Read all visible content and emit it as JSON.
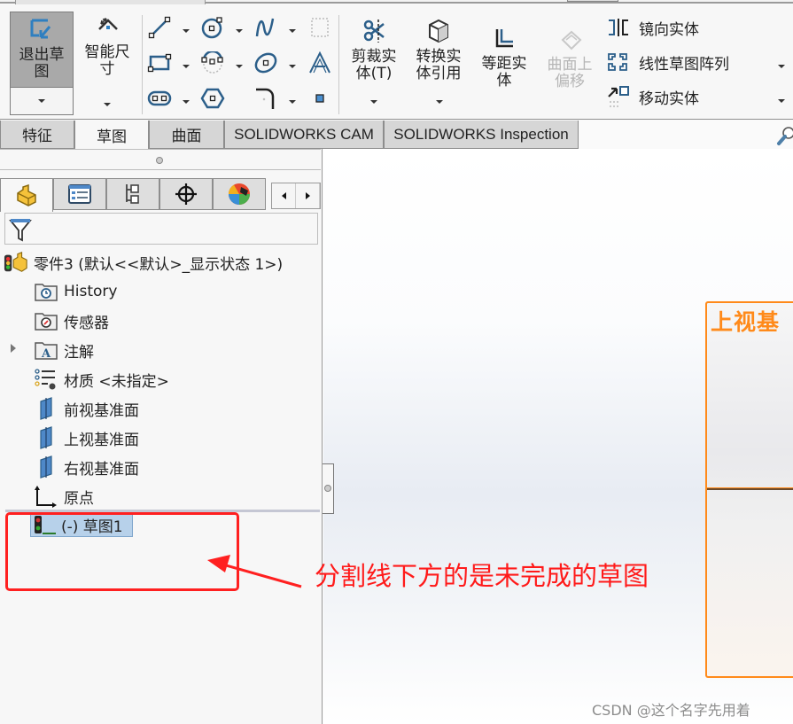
{
  "ribbon": {
    "exit_sketch": {
      "line1": "退出草",
      "line2": "图"
    },
    "smart_dimension": {
      "line1": "智能尺",
      "line2": "寸"
    },
    "sketch_tools": [
      {
        "name": "line",
        "has_dropdown": true
      },
      {
        "name": "circle",
        "has_dropdown": true
      },
      {
        "name": "spline",
        "has_dropdown": true
      },
      {
        "name": "construction-geometry",
        "has_dropdown": false
      },
      {
        "name": "rectangle",
        "has_dropdown": true
      },
      {
        "name": "arc",
        "has_dropdown": true
      },
      {
        "name": "ellipse",
        "has_dropdown": true
      },
      {
        "name": "text",
        "has_dropdown": false
      },
      {
        "name": "slot",
        "has_dropdown": true
      },
      {
        "name": "polygon",
        "has_dropdown": false
      },
      {
        "name": "fillet",
        "has_dropdown": true
      },
      {
        "name": "point",
        "has_dropdown": false
      }
    ],
    "trim_entities": {
      "line1": "剪裁实",
      "line2": "体(T)"
    },
    "convert_entities": {
      "line1": "转换实",
      "line2": "体引用"
    },
    "offset_entities": {
      "line1": "等距实",
      "line2": "体"
    },
    "offset_on_surface": {
      "line1": "曲面上",
      "line2": "偏移",
      "disabled": true
    },
    "mirror_entities": "镜向实体",
    "linear_pattern": "线性草图阵列",
    "move_entities": "移动实体"
  },
  "tabs": [
    {
      "label": "特征",
      "active": false
    },
    {
      "label": "草图",
      "active": true
    },
    {
      "label": "曲面",
      "active": false
    },
    {
      "label": "SOLIDWORKS CAM",
      "active": false
    },
    {
      "label": "SOLIDWORKS Inspection",
      "active": false
    }
  ],
  "panel_tabs": [
    {
      "icon": "feature-manager-icon",
      "active": true
    },
    {
      "icon": "property-manager-icon",
      "active": false
    },
    {
      "icon": "configuration-manager-icon",
      "active": false
    },
    {
      "icon": "dimxpert-icon",
      "active": false
    },
    {
      "icon": "display-manager-icon",
      "active": false
    }
  ],
  "tree": {
    "root": "零件3  (默认<<默认>_显示状态 1>)",
    "items": [
      {
        "label": "History",
        "icon": "history-folder-icon"
      },
      {
        "label": "传感器",
        "icon": "sensors-folder-icon"
      },
      {
        "label": "注解",
        "icon": "annotations-folder-icon",
        "expandable": true
      },
      {
        "label": "材质 <未指定>",
        "icon": "material-icon"
      },
      {
        "label": "前视基准面",
        "icon": "plane-icon"
      },
      {
        "label": "上视基准面",
        "icon": "plane-icon"
      },
      {
        "label": "右视基准面",
        "icon": "plane-icon"
      },
      {
        "label": "原点",
        "icon": "origin-icon"
      }
    ],
    "sketch": "(-) 草图1"
  },
  "graphics": {
    "plane_label": "上视基"
  },
  "annotation": {
    "text": "分割线下方的是未完成的草图",
    "color": "#ff1a1a"
  },
  "watermark": "CSDN @这个名字先用着",
  "colors": {
    "plane_highlight": "#ff8a1a",
    "selection": "#b7d1ea"
  }
}
